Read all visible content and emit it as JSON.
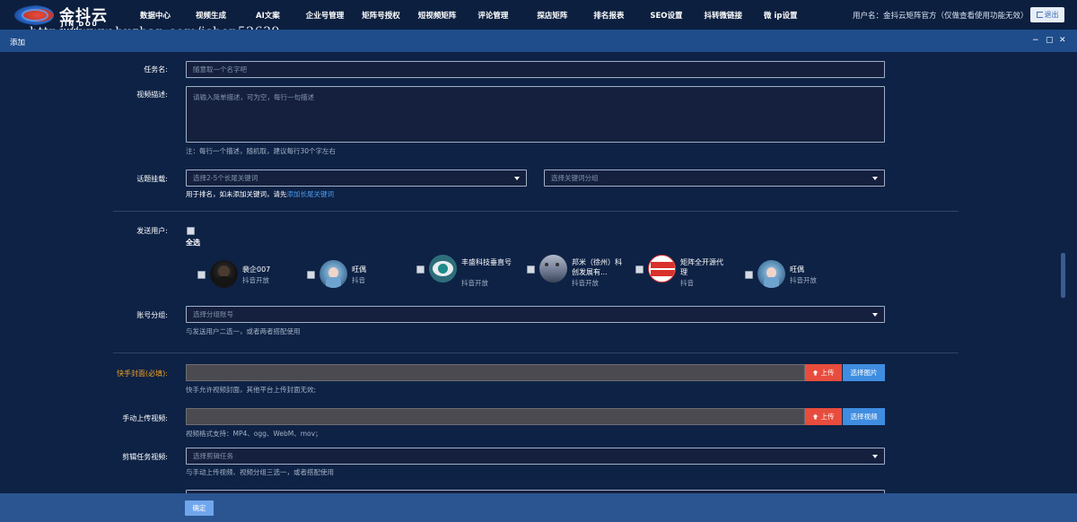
{
  "app": {
    "logo_cn": "金抖云",
    "logo_en": "JIN DOU YUN",
    "nav": [
      "数据中心",
      "视频生成",
      "AI文案",
      "企业号管理",
      "矩阵号授权",
      "短视频矩阵",
      "评论管理",
      "探店矩阵",
      "排名报表",
      "SEO设置",
      "抖转微链接",
      "微 ip设置"
    ],
    "user_info": "用户名：金抖云矩阵官方（仅做查看使用功能无效）",
    "logout_label": "退出",
    "watermark": "https://www.huzhan.com/ishop52639"
  },
  "dialog": {
    "title": "添加",
    "win_buttons": [
      "−",
      "▢",
      "✕"
    ]
  },
  "form": {
    "task_name": {
      "label": "任务名:",
      "placeholder": "随意取一个名字吧"
    },
    "video_desc": {
      "label": "视频描述:",
      "placeholder": "请输入简单描述，可为空，每行一句描述",
      "hint": "注：每行一个描述，随机取，建议每行30个字左右"
    },
    "topic": {
      "label": "话题挂载:",
      "keyword_placeholder": "选择2-5个长尾关键词",
      "group_placeholder": "选择关键词分组",
      "hint_prefix": "用于排名，如未添加关键词，请先",
      "hint_link": "添加长尾关键词"
    },
    "send_users": {
      "label": "发送用户:",
      "select_all": "全选",
      "accounts": [
        {
          "name": "裴企007",
          "platform": "抖音开放"
        },
        {
          "name": "旺偶",
          "platform": "抖音"
        },
        {
          "name": "丰盛科技垂直号",
          "platform": "抖音开放"
        },
        {
          "name": "邦米（徐州）科创发展有...",
          "platform": "抖音开放"
        },
        {
          "name": "矩阵全开源代理",
          "platform": "抖音"
        },
        {
          "name": "旺偶",
          "platform": "抖音开放"
        }
      ]
    },
    "account_group": {
      "label": "账号分组:",
      "placeholder": "选择分组账号",
      "hint": "与发送用户二选一，或者两者搭配使用"
    },
    "kuaishou_cover": {
      "label": "快手封面(必填):",
      "upload_label": "上传",
      "choose_label": "选择图片",
      "hint": "快手允许视频封面，其他平台上传封面无效;"
    },
    "manual_video": {
      "label": "手动上传视频:",
      "upload_label": "上传",
      "choose_label": "选择视频",
      "hint": "视频格式支持：MP4、ogg、WebM、mov；"
    },
    "clip_task": {
      "label": "剪辑任务视频:",
      "placeholder": "选择剪辑任务",
      "hint": "与手动上传视频、视频分组三选一，或者搭配使用"
    }
  },
  "footer": {
    "ok_label": "确定"
  },
  "colors": {
    "accent": "#3e8de0",
    "danger": "#e74c3c",
    "required": "#f0a020"
  }
}
